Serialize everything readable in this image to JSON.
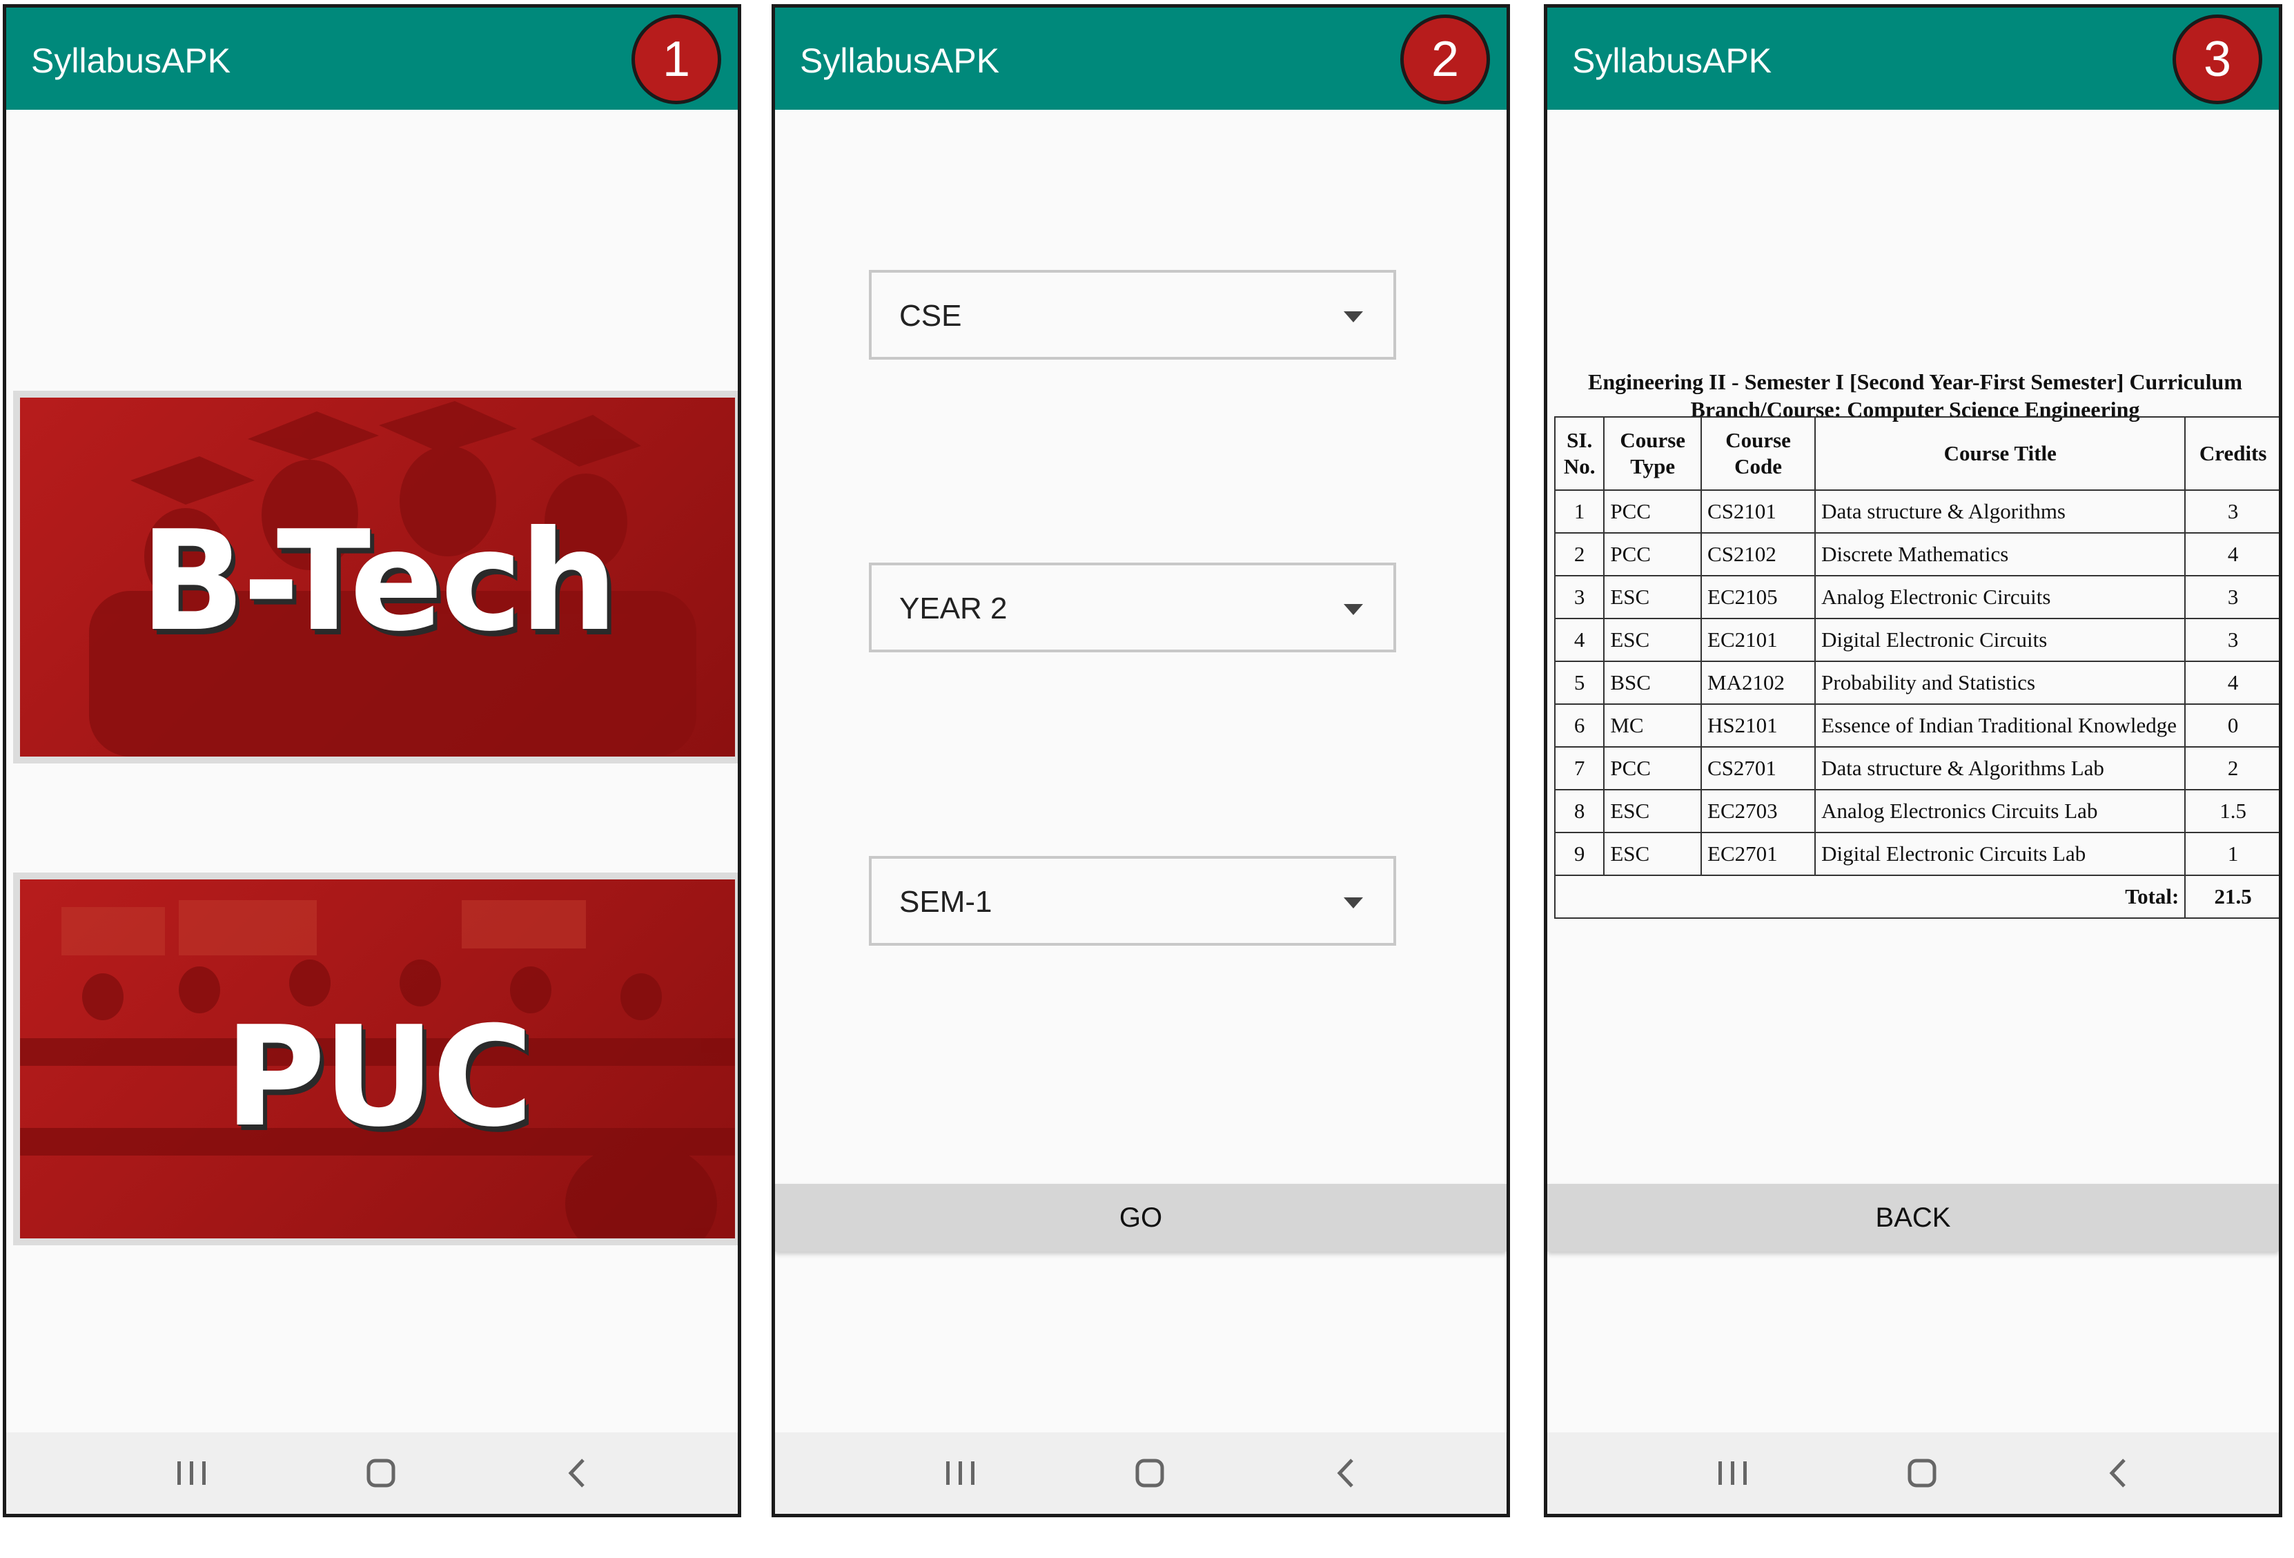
{
  "app": {
    "title": "SyllabusAPK"
  },
  "steps": [
    "1",
    "2",
    "3"
  ],
  "screen1": {
    "tiles": [
      {
        "label": "B-Tech"
      },
      {
        "label": "PUC"
      }
    ]
  },
  "screen2": {
    "branch": "CSE",
    "year": "YEAR 2",
    "semester": "SEM-1",
    "go_label": "GO"
  },
  "screen3": {
    "heading_line1": "Engineering II - Semester I [Second Year-First Semester] Curriculum",
    "heading_line2": "Branch/Course: Computer Science Engineering",
    "columns": [
      "SI. No.",
      "Course Type",
      "Course Code",
      "Course Title",
      "Credits"
    ],
    "rows": [
      {
        "sl": "1",
        "type": "PCC",
        "code": "CS2101",
        "title": "Data structure & Algorithms",
        "credits": "3"
      },
      {
        "sl": "2",
        "type": "PCC",
        "code": "CS2102",
        "title": "Discrete Mathematics",
        "credits": "4"
      },
      {
        "sl": "3",
        "type": "ESC",
        "code": "EC2105",
        "title": "Analog Electronic Circuits",
        "credits": "3"
      },
      {
        "sl": "4",
        "type": "ESC",
        "code": "EC2101",
        "title": "Digital Electronic Circuits",
        "credits": "3"
      },
      {
        "sl": "5",
        "type": "BSC",
        "code": "MA2102",
        "title": "Probability and Statistics",
        "credits": "4"
      },
      {
        "sl": "6",
        "type": "MC",
        "code": "HS2101",
        "title": "Essence of Indian Traditional Knowledge",
        "credits": "0"
      },
      {
        "sl": "7",
        "type": "PCC",
        "code": "CS2701",
        "title": "Data structure & Algorithms Lab",
        "credits": "2"
      },
      {
        "sl": "8",
        "type": "ESC",
        "code": "EC2703",
        "title": "Analog Electronics Circuits Lab",
        "credits": "1.5"
      },
      {
        "sl": "9",
        "type": "ESC",
        "code": "EC2701",
        "title": "Digital Electronic Circuits Lab",
        "credits": "1"
      }
    ],
    "total_label": "Total:",
    "total_value": "21.5",
    "back_label": "BACK"
  },
  "navbar": {
    "icons": [
      "recent-apps-icon",
      "home-icon",
      "back-icon"
    ]
  },
  "colors": {
    "appbar": "#00897b",
    "badge": "#b71c1c",
    "tile": "#b71c1c"
  }
}
